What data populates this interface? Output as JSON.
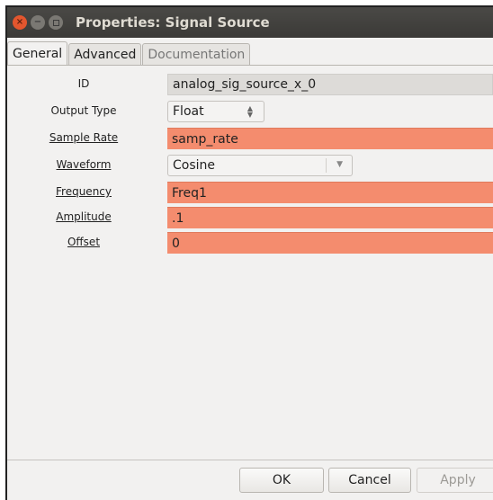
{
  "window": {
    "title": "Properties: Signal Source",
    "close_glyph": "×",
    "min_glyph": "−"
  },
  "tabs": [
    {
      "label": "General",
      "active": true
    },
    {
      "label": "Advanced",
      "active": false
    },
    {
      "label": "Documentation",
      "active": false
    }
  ],
  "fields": {
    "id": {
      "label": "ID",
      "value": "analog_sig_source_x_0"
    },
    "output_type": {
      "label": "Output Type",
      "value": "Float"
    },
    "sample_rate": {
      "label": "Sample Rate",
      "value": "samp_rate"
    },
    "waveform": {
      "label": "Waveform",
      "value": "Cosine"
    },
    "frequency": {
      "label": "Frequency",
      "value": "Freq1"
    },
    "amplitude": {
      "label": "Amplitude",
      "value": ".1"
    },
    "offset": {
      "label": "Offset",
      "value": "0"
    }
  },
  "buttons": {
    "ok": "OK",
    "cancel": "Cancel",
    "apply": "Apply"
  },
  "colors": {
    "highlight_field": "#f48c6e",
    "titlebar": "#3b3a37",
    "close_button": "#e3562e"
  },
  "icons": {
    "close": "close-icon",
    "minimize": "minimize-icon",
    "maximize": "maximize-icon",
    "spinner": "spinner-arrows-icon",
    "dropdown": "chevron-down-icon"
  }
}
